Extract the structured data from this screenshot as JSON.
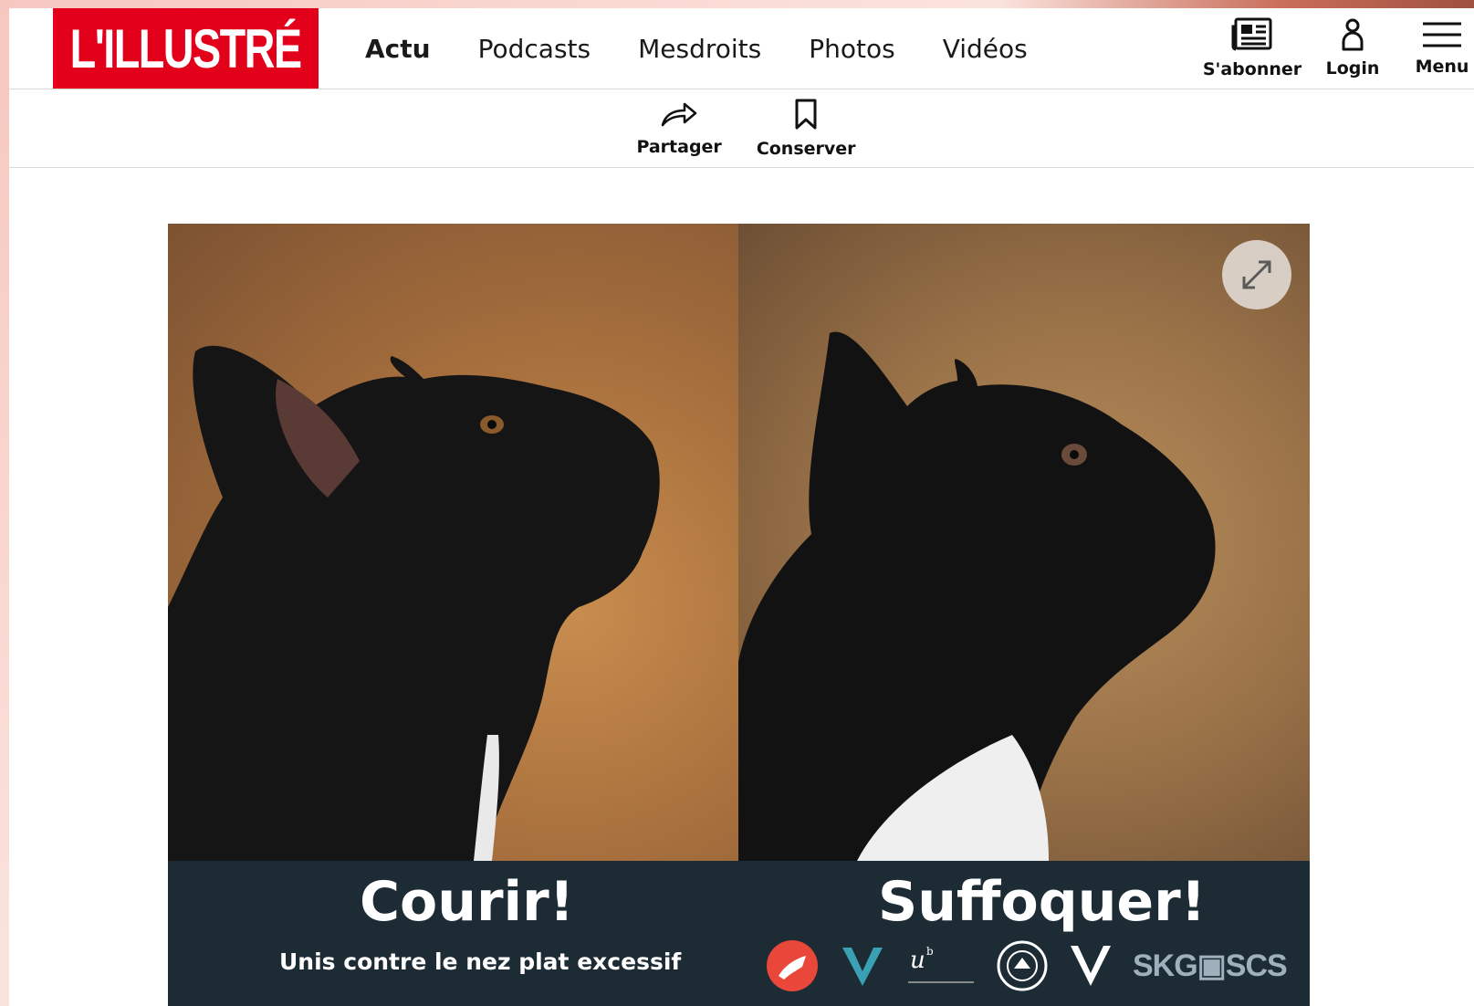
{
  "header": {
    "logo_text": "L'ILLUSTRÉ",
    "brand_color": "#e2001a",
    "nav": [
      {
        "label": "Actu",
        "active": true
      },
      {
        "label": "Podcasts",
        "active": false
      },
      {
        "label": "Mesdroits",
        "active": false
      },
      {
        "label": "Photos",
        "active": false
      },
      {
        "label": "Vidéos",
        "active": false
      }
    ],
    "actions": {
      "subscribe_label": "S'abonner",
      "subscribe_icon": "newspaper-icon",
      "login_label": "Login",
      "login_icon": "user-icon",
      "menu_label": "Menu",
      "menu_icon": "hamburger-icon"
    }
  },
  "toolbar": {
    "share_label": "Partager",
    "share_icon": "share-arrow-icon",
    "save_label": "Conserver",
    "save_icon": "bookmark-icon"
  },
  "hero": {
    "expand_icon": "expand-icon",
    "caption_left_title": "Courir!",
    "caption_right_title": "Suffoquer!",
    "caption_subtitle": "Unis contre le nez plat excessif",
    "partner_logo_text": "SKG▣SCS",
    "caption_band_color": "#1c2b34"
  }
}
